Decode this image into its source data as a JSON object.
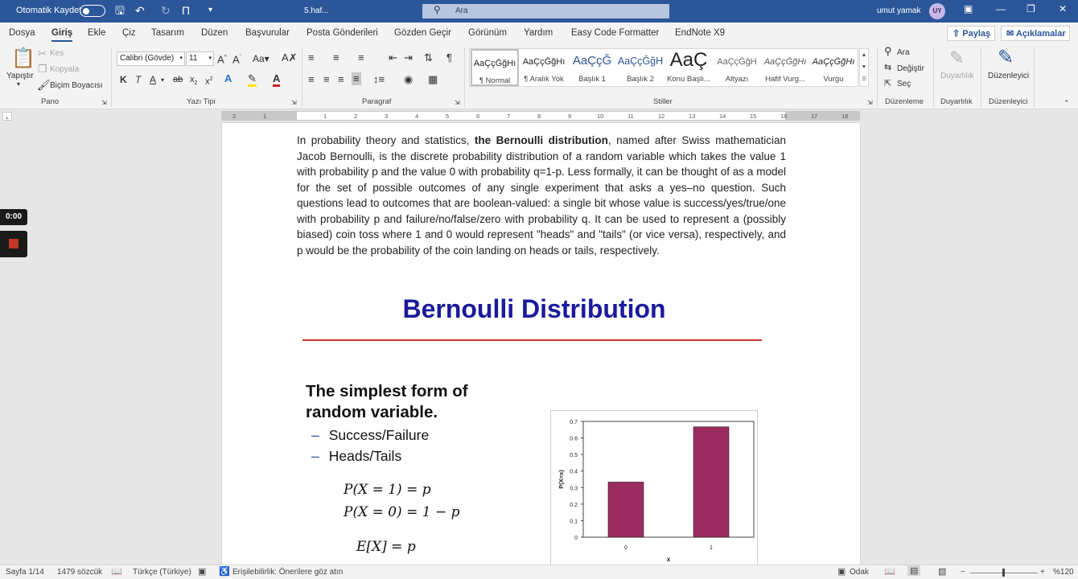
{
  "titlebar": {
    "autosave_label": "Otomatik Kaydet",
    "doc_name": "5.haf...",
    "search_placeholder": "Ara",
    "user_name": "umut yamak",
    "user_initials": "UY"
  },
  "tabs": [
    "Dosya",
    "Giriş",
    "Ekle",
    "Çiz",
    "Tasarım",
    "Düzen",
    "Başvurular",
    "Posta Gönderileri",
    "Gözden Geçir",
    "Görünüm",
    "Yardım",
    "Easy Code Formatter",
    "EndNote X9"
  ],
  "share_label": "Paylaş",
  "comments_label": "Açıklamalar",
  "clipboard": {
    "paste": "Yapıştır",
    "cut": "Kes",
    "copy": "Kopyala",
    "format_painter": "Biçim Boyacısı",
    "group": "Pano"
  },
  "font": {
    "name": "Calibri (Gövde)",
    "size": "11",
    "group": "Yazı Tipi"
  },
  "paragraph_group": "Paragraf",
  "styles": {
    "group": "Stiller",
    "items": [
      {
        "preview": "AaÇçĞğHı",
        "name": "¶ Normal"
      },
      {
        "preview": "AaÇçĞğHı",
        "name": "¶ Aralık Yok"
      },
      {
        "preview": "AaÇçĞ",
        "name": "Başlık 1"
      },
      {
        "preview": "AaÇçĞğH",
        "name": "Başlık 2"
      },
      {
        "preview": "AaÇ",
        "name": "Konu Başlı..."
      },
      {
        "preview": "AaÇçĞğH",
        "name": "Altyazı"
      },
      {
        "preview": "AaÇçĞğHı",
        "name": "Hafif Vurg..."
      },
      {
        "preview": "AaÇçĞğHı",
        "name": "Vurgu"
      }
    ]
  },
  "editing": {
    "find": "Ara",
    "replace": "Değiştir",
    "select": "Seç",
    "group": "Düzenleme"
  },
  "sensitivity": {
    "label": "Duyarlılık",
    "group": "Duyarlılık"
  },
  "editor": {
    "label": "Düzenleyici",
    "group": "Düzenleyici"
  },
  "ruler_numbers": [
    "2",
    "1",
    "1",
    "2",
    "3",
    "4",
    "5",
    "6",
    "7",
    "8",
    "9",
    "10",
    "11",
    "12",
    "13",
    "14",
    "15",
    "16",
    "17",
    "18"
  ],
  "recorder_time": "0:00",
  "document": {
    "para_before_bold": "In probability theory and statistics, ",
    "para_bold": "the Bernoulli distribution",
    "para_after_bold": ", named after Swiss mathematician Jacob Bernoulli, is the discrete probability distribution of a random variable which takes the value 1 with probability p and the value 0 with probability q=1-p. Less formally, it can be thought of as a model for the set of possible outcomes of any single experiment that asks a yes–no question. Such questions lead to outcomes that are boolean-valued: a single bit whose value is success/yes/true/one with probability p and failure/no/false/zero with probability q. It can be used to represent a (possibly biased) coin toss where 1 and 0 would represent \"heads\" and \"tails\" (or vice versa), respectively, and p would be the probability of the coin landing on heads or tails, respectively.",
    "slide_title": "Bernoulli Distribution",
    "slide_heading": "The simplest form of random variable.",
    "bullets": [
      "Success/Failure",
      "Heads/Tails"
    ],
    "formula1": "P(X = 1) = p",
    "formula2": "P(X = 0) = 1 − p",
    "formula3": "E[X] = p"
  },
  "chart_data": {
    "type": "bar",
    "categories": [
      "0",
      "1"
    ],
    "values": [
      0.333,
      0.667
    ],
    "xlabel": "x",
    "ylabel": "P(X=x)",
    "ylim": [
      0,
      0.7
    ],
    "yticks": [
      "0",
      "0.1",
      "0.2",
      "0.3",
      "0.4",
      "0.5",
      "0.6",
      "0.7"
    ],
    "bar_color": "#9b2c60"
  },
  "status": {
    "page": "Sayfa 1/14",
    "words": "1479 sözcük",
    "language": "Türkçe (Türkiye)",
    "accessibility": "Erişilebilirlik: Önerilere göz atın",
    "focus": "Odak",
    "zoom": "%120"
  }
}
